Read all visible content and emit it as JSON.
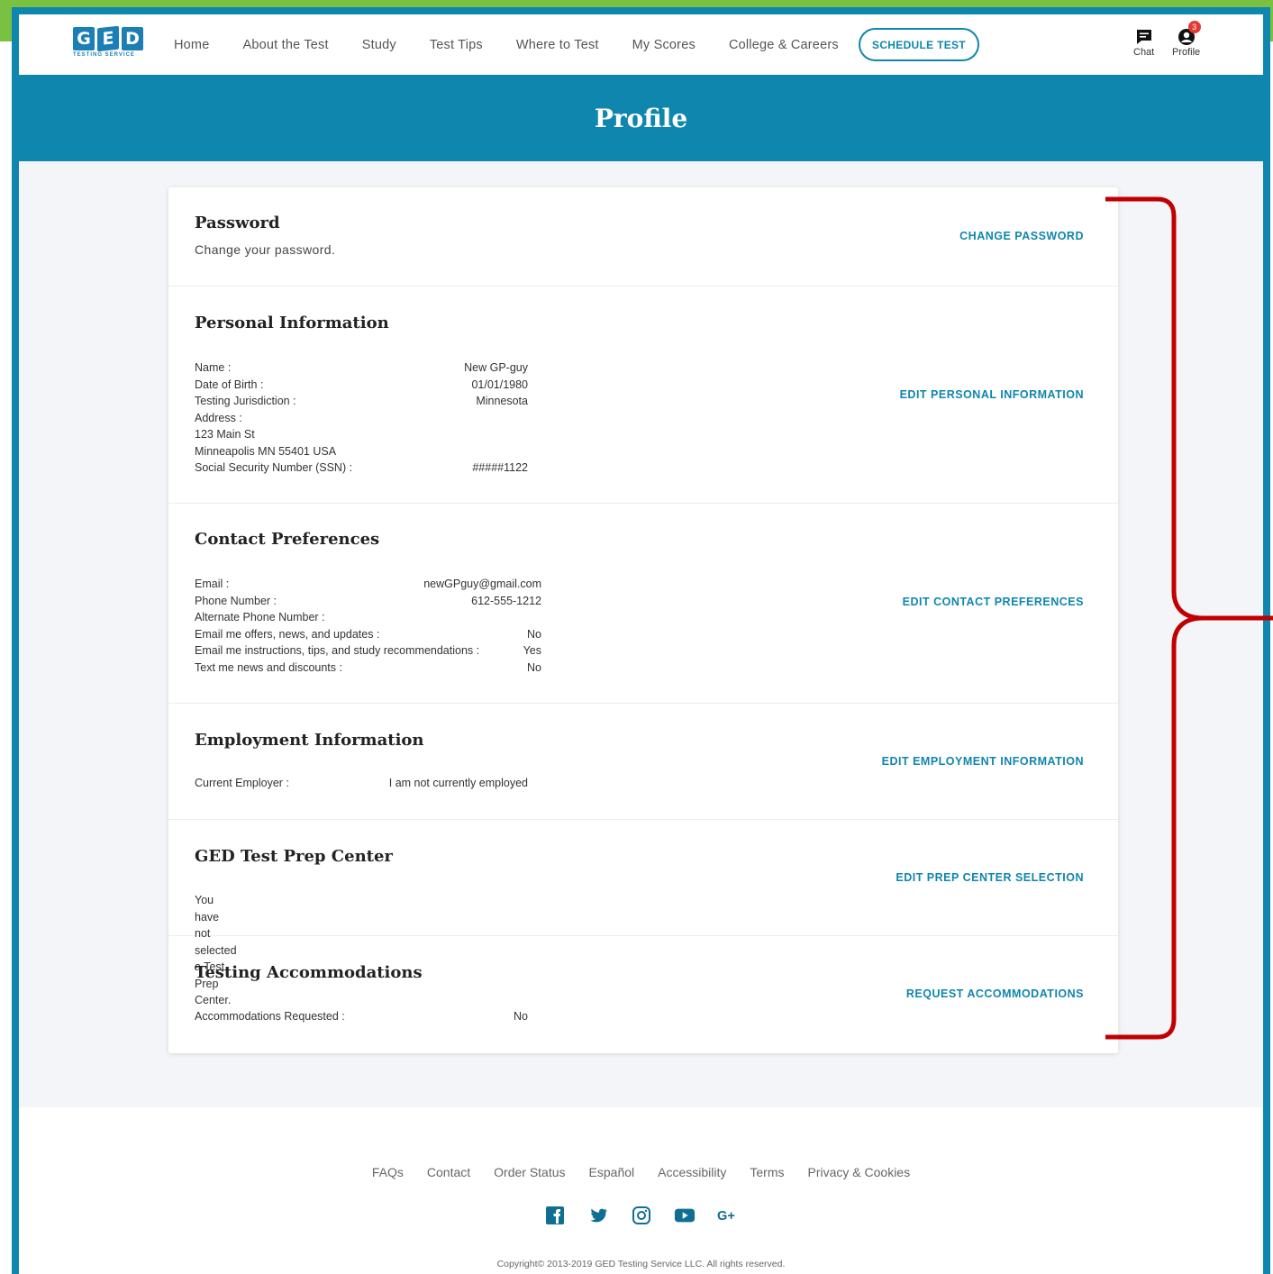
{
  "nav": {
    "logo_letters": [
      "G",
      "E",
      "D"
    ],
    "logo_sub": "TESTING SERVICE",
    "links": [
      "Home",
      "About the Test",
      "Study",
      "Test Tips",
      "Where to Test",
      "My Scores",
      "College & Careers"
    ],
    "schedule_label": "SCHEDULE TEST",
    "chat_label": "Chat",
    "profile_label": "Profile",
    "profile_badge": "3"
  },
  "page": {
    "title": "Profile"
  },
  "sections": {
    "password": {
      "title": "Password",
      "description": "Change your password.",
      "action": "CHANGE PASSWORD"
    },
    "personal": {
      "title": "Personal Information",
      "action": "EDIT PERSONAL INFORMATION",
      "rows": [
        {
          "label": "Name :",
          "value": "New GP-guy"
        },
        {
          "label": "Date of Birth :",
          "value": "01/01/1980"
        },
        {
          "label": "Testing Jurisdiction :",
          "value": "Minnesota"
        },
        {
          "label": "Address :",
          "value": ""
        },
        {
          "label": "123 Main St",
          "value": ""
        },
        {
          "label": "Minneapolis MN 55401 USA",
          "value": ""
        },
        {
          "label": "Social Security Number (SSN) :",
          "value": "#####1122"
        }
      ]
    },
    "contact": {
      "title": "Contact Preferences",
      "action": "EDIT CONTACT PREFERENCES",
      "rows": [
        {
          "label": "Email :",
          "value": "newGPguy@gmail.com"
        },
        {
          "label": "Phone Number :",
          "value": "612-555-1212"
        },
        {
          "label": "Alternate Phone Number :",
          "value": ""
        },
        {
          "label": "Email me offers, news, and updates :",
          "value": "No"
        },
        {
          "label": "Email me instructions, tips, and study recommendations :",
          "value": "Yes"
        },
        {
          "label": "Text me news and discounts :",
          "value": "No"
        }
      ]
    },
    "employment": {
      "title": "Employment Information",
      "action": "EDIT EMPLOYMENT INFORMATION",
      "rows": [
        {
          "label": "Current Employer :",
          "value": "I am not currently employed"
        }
      ]
    },
    "prep": {
      "title": "GED Test Prep Center",
      "action": "EDIT PREP CENTER SELECTION",
      "description": "You have not selected a Test Prep Center."
    },
    "accommodations": {
      "title": "Testing Accommodations",
      "action": "REQUEST ACCOMMODATIONS",
      "rows": [
        {
          "label": "Accommodations Requested :",
          "value": "No"
        }
      ]
    }
  },
  "footer": {
    "links": [
      "FAQs",
      "Contact",
      "Order Status",
      "Español",
      "Accessibility",
      "Terms",
      "Privacy & Cookies"
    ],
    "social": [
      "facebook-icon",
      "twitter-icon",
      "instagram-icon",
      "youtube-icon",
      "google-plus-icon"
    ],
    "copyright": "Copyright© 2013-2019 GED Testing Service LLC. All rights reserved."
  },
  "colors": {
    "brand": "#0f86ad",
    "accent_green": "#7ac142",
    "annotation_red": "#c00000",
    "badge": "#e53935"
  }
}
